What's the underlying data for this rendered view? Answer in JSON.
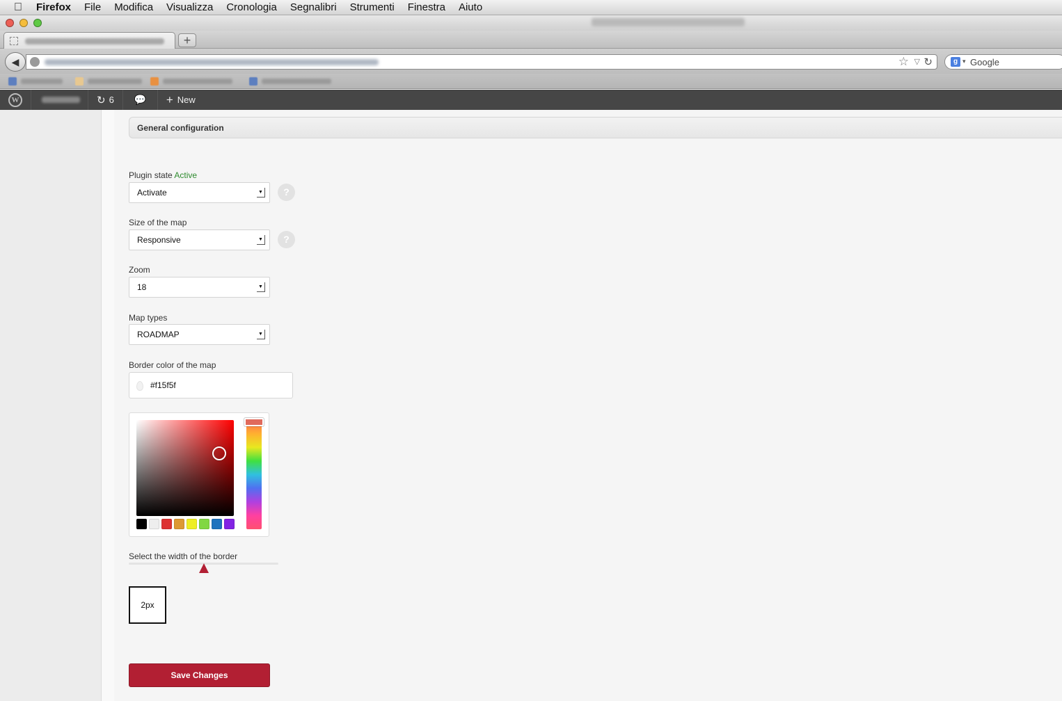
{
  "menubar": {
    "app": "Firefox",
    "items": [
      "File",
      "Modifica",
      "Visualizza",
      "Cronologia",
      "Segnalibri",
      "Strumenti",
      "Finestra",
      "Aiuto"
    ]
  },
  "browser": {
    "new_tab_glyph": "+",
    "search_placeholder": "Google"
  },
  "adminbar": {
    "updates_count": "6",
    "new_label": "New"
  },
  "panel": {
    "title": "General configuration"
  },
  "fields": {
    "plugin_state": {
      "label": "Plugin state",
      "status": "Active",
      "value": "Activate"
    },
    "map_size": {
      "label": "Size of the map",
      "value": "Responsive"
    },
    "zoom": {
      "label": "Zoom",
      "value": "18"
    },
    "map_types": {
      "label": "Map types",
      "value": "ROADMAP"
    },
    "border_color": {
      "label": "Border color of the map",
      "value": "#f15f5f"
    },
    "border_width": {
      "label": "Select the width of the border",
      "value": "2px",
      "fraction": 0.5
    }
  },
  "help_glyph": "?",
  "picker": {
    "swatches": [
      "#000000",
      "#eeeeee",
      "#dd3333",
      "#dd9933",
      "#eeee22",
      "#81d742",
      "#1e73be",
      "#8224e3"
    ]
  },
  "save_label": "Save Changes"
}
